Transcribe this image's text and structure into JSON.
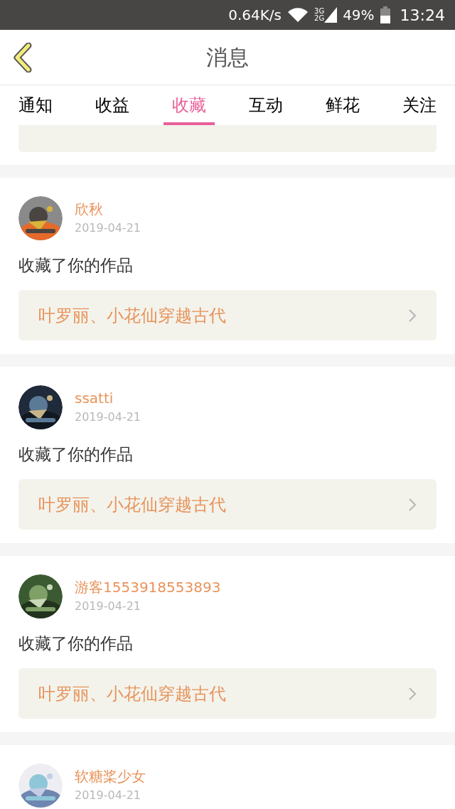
{
  "status_bar": {
    "speed": "0.64K/s",
    "network_top": "3G",
    "network_bottom": "2G",
    "battery": "49%",
    "time": "13:24"
  },
  "header": {
    "title": "消息"
  },
  "tabs": [
    {
      "label": "通知",
      "selected": false
    },
    {
      "label": "收益",
      "selected": false
    },
    {
      "label": "收藏",
      "selected": true
    },
    {
      "label": "互动",
      "selected": false
    },
    {
      "label": "鲜花",
      "selected": false
    },
    {
      "label": "关注",
      "selected": false
    }
  ],
  "messages": [
    {
      "user": "欣秋",
      "date": "2019-04-21",
      "action": "收藏了你的作品",
      "work": "叶罗丽、小花仙穿越古代"
    },
    {
      "user": "ssatti",
      "date": "2019-04-21",
      "action": "收藏了你的作品",
      "work": "叶罗丽、小花仙穿越古代"
    },
    {
      "user": "游客1553918553893",
      "date": "2019-04-21",
      "action": "收藏了你的作品",
      "work": "叶罗丽、小花仙穿越古代"
    },
    {
      "user": "软糖桨少女",
      "date": "2019-04-21"
    }
  ]
}
